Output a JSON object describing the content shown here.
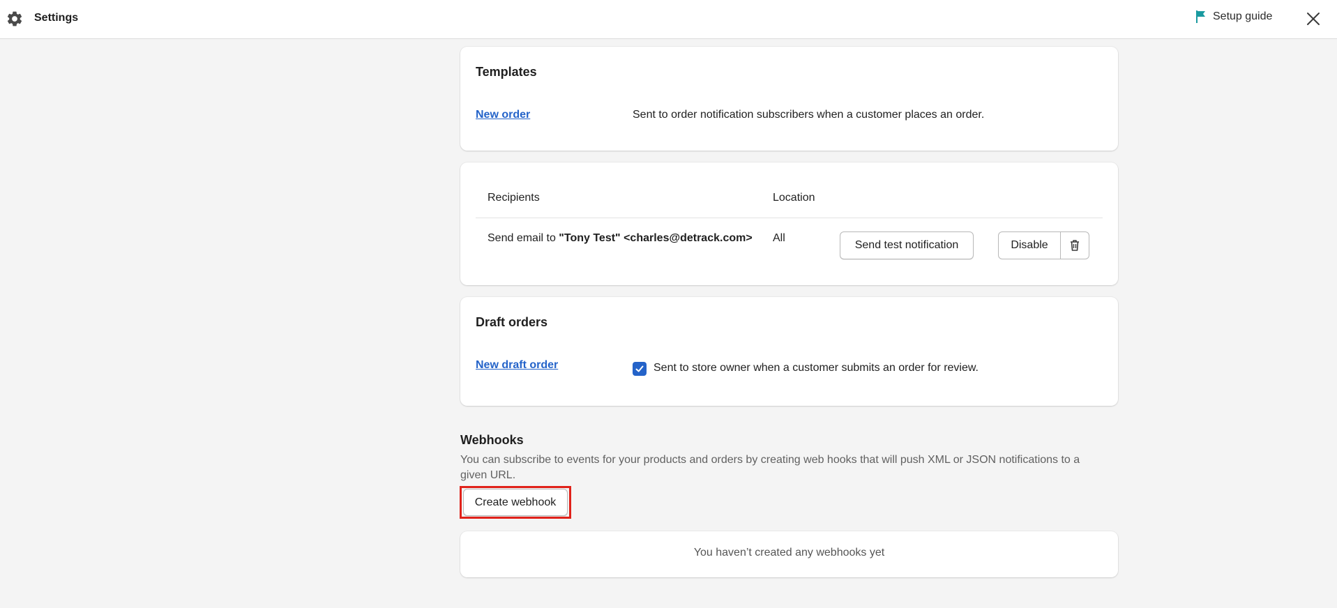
{
  "header": {
    "title": "Settings",
    "setup_guide_label": "Setup guide",
    "flag_color": "#1a9aa0"
  },
  "templates": {
    "title": "Templates",
    "link": "New order",
    "description": "Sent to order notification subscribers when a customer places an order."
  },
  "recipients": {
    "col_recipients": "Recipients",
    "col_location": "Location",
    "row_prefix": "Send email to ",
    "row_email": "\"Tony Test\" <charles@detrack.com>",
    "row_location": "All",
    "send_test_label": "Send test notification",
    "disable_label": "Disable"
  },
  "draft_orders": {
    "title": "Draft orders",
    "link": "New draft order",
    "checkbox_checked": true,
    "description": "Sent to store owner when a customer submits an order for review."
  },
  "webhooks": {
    "title": "Webhooks",
    "description": "You can subscribe to events for your products and orders by creating web hooks that will push XML or JSON notifications to a given URL.",
    "create_label": "Create webhook",
    "empty_text": "You haven’t created any webhooks yet"
  },
  "colors": {
    "link": "#2463c9",
    "highlight": "#e0221a",
    "checkbox": "#2463c9"
  }
}
